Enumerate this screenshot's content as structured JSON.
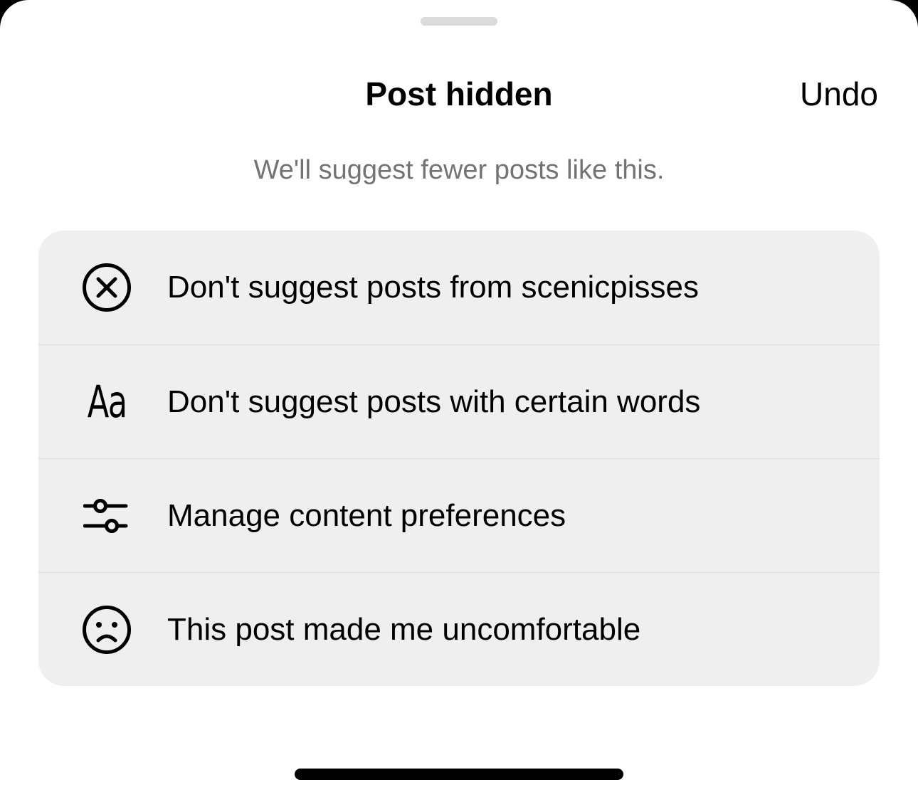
{
  "sheet": {
    "title": "Post hidden",
    "undo_label": "Undo",
    "subtitle": "We'll suggest fewer posts like this."
  },
  "menu": {
    "items": [
      {
        "icon": "circle-x-icon",
        "label": "Don't suggest posts from scenicpisses"
      },
      {
        "icon": "text-aa-icon",
        "label": "Don't suggest posts with certain words",
        "icon_text": "Aa"
      },
      {
        "icon": "sliders-icon",
        "label": "Manage content preferences"
      },
      {
        "icon": "sad-face-icon",
        "label": "This post made me uncomfortable"
      }
    ]
  },
  "colors": {
    "sheet_background": "#ffffff",
    "menu_background": "#efefef",
    "subtitle_text": "#737373",
    "grabber": "#dbdbdb"
  }
}
